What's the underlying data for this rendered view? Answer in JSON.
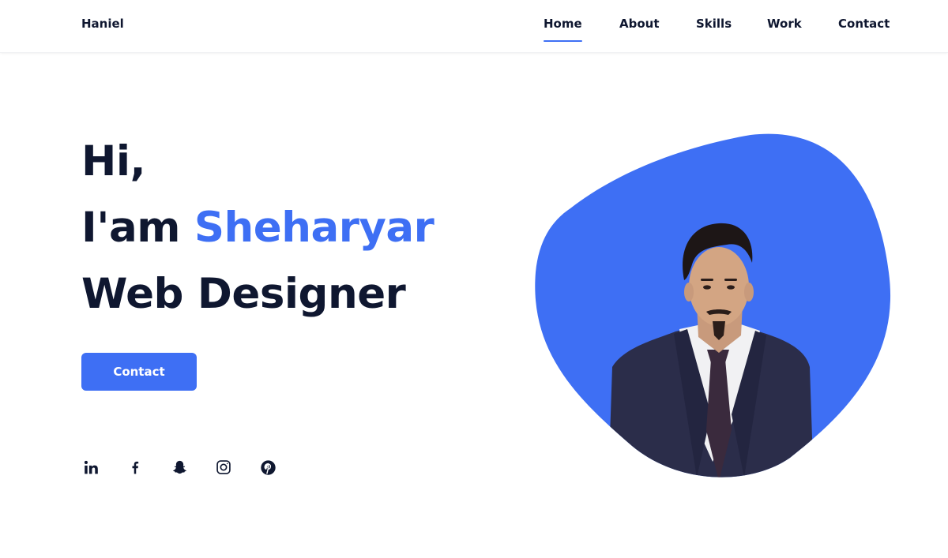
{
  "header": {
    "logo": "Haniel",
    "nav": [
      {
        "label": "Home",
        "active": true
      },
      {
        "label": "About",
        "active": false
      },
      {
        "label": "Skills",
        "active": false
      },
      {
        "label": "Work",
        "active": false
      },
      {
        "label": "Contact",
        "active": false
      }
    ]
  },
  "hero": {
    "greeting": "Hi,",
    "intro_prefix": "I'am ",
    "name": "Sheharyar",
    "role": "Web Designer",
    "button_label": "Contact"
  },
  "social": [
    {
      "icon": "linkedin-icon"
    },
    {
      "icon": "facebook-icon"
    },
    {
      "icon": "snapchat-icon"
    },
    {
      "icon": "instagram-icon"
    },
    {
      "icon": "pinterest-icon"
    }
  ],
  "colors": {
    "accent": "#3e6ff4",
    "text": "#0f1730",
    "background": "#ffffff"
  }
}
